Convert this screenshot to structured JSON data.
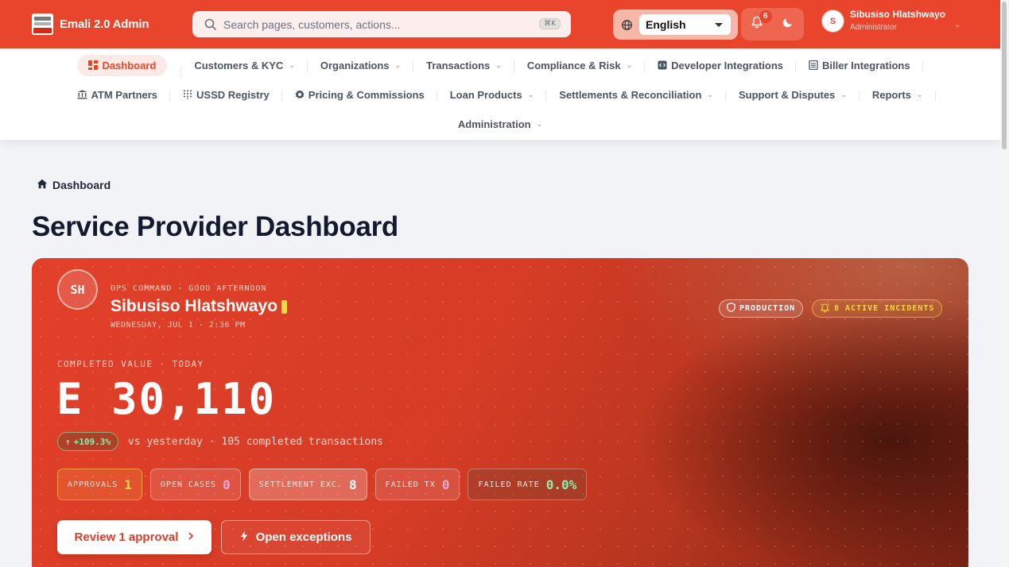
{
  "brand": {
    "name": "Emali 2.0 Admin"
  },
  "search": {
    "placeholder": "Search pages, customers, actions...",
    "shortcut": "⌘K"
  },
  "language": {
    "selected": "English"
  },
  "notifications": {
    "count": "6"
  },
  "user": {
    "initial": "S",
    "name": "Sibusiso Hlatshwayo",
    "role": "Administrator"
  },
  "nav": {
    "row1": [
      {
        "label": "Dashboard",
        "icon": "grid-icon",
        "active": true
      },
      {
        "label": "Customers & KYC",
        "chevron": true
      },
      {
        "label": "Organizations",
        "chevron": true
      },
      {
        "label": "Transactions",
        "chevron": true
      },
      {
        "label": "Compliance & Risk",
        "chevron": true
      },
      {
        "label": "Developer Integrations",
        "icon": "code-icon"
      },
      {
        "label": "Biller Integrations",
        "icon": "receipt-icon"
      }
    ],
    "row2": [
      {
        "label": "ATM Partners",
        "icon": "bank-icon"
      },
      {
        "label": "USSD Registry",
        "icon": "dialpad-icon"
      },
      {
        "label": "Pricing & Commissions",
        "icon": "badge-icon"
      },
      {
        "label": "Loan Products",
        "chevron": true
      },
      {
        "label": "Settlements & Reconciliation",
        "chevron": true
      },
      {
        "label": "Support & Disputes",
        "chevron": true
      },
      {
        "label": "Reports",
        "chevron": true
      }
    ],
    "row3": [
      {
        "label": "Administration",
        "chevron": true
      }
    ]
  },
  "breadcrumb": {
    "label": "Dashboard"
  },
  "page": {
    "title": "Service Provider Dashboard"
  },
  "hero": {
    "initials": "SH",
    "greeting": "OPS COMMAND · GOOD AFTERNOON",
    "name": "Sibusiso Hlatshwayo",
    "date": "WEDNESDAY, JUL 1 · 2:36 PM",
    "env_tag": "PRODUCTION",
    "incidents_tag": "8 ACTIVE INCIDENTS",
    "value_label": "COMPLETED VALUE · TODAY",
    "value": "E 30,110",
    "delta": "+109.3%",
    "delta_text": "vs yesterday · 105 completed transactions",
    "stats": [
      {
        "key": "APPROVALS",
        "value": "1"
      },
      {
        "key": "OPEN CASES",
        "value": "0"
      },
      {
        "key": "SETTLEMENT EXC.",
        "value": "8"
      },
      {
        "key": "FAILED TX",
        "value": "0"
      },
      {
        "key": "FAILED RATE",
        "value": "0.0%"
      }
    ],
    "primary_button": "Review 1 approval",
    "secondary_button": "Open exceptions"
  },
  "colors": {
    "brand": "#e8452c",
    "accent_yellow": "#fcd34d",
    "accent_green": "#86efac"
  }
}
